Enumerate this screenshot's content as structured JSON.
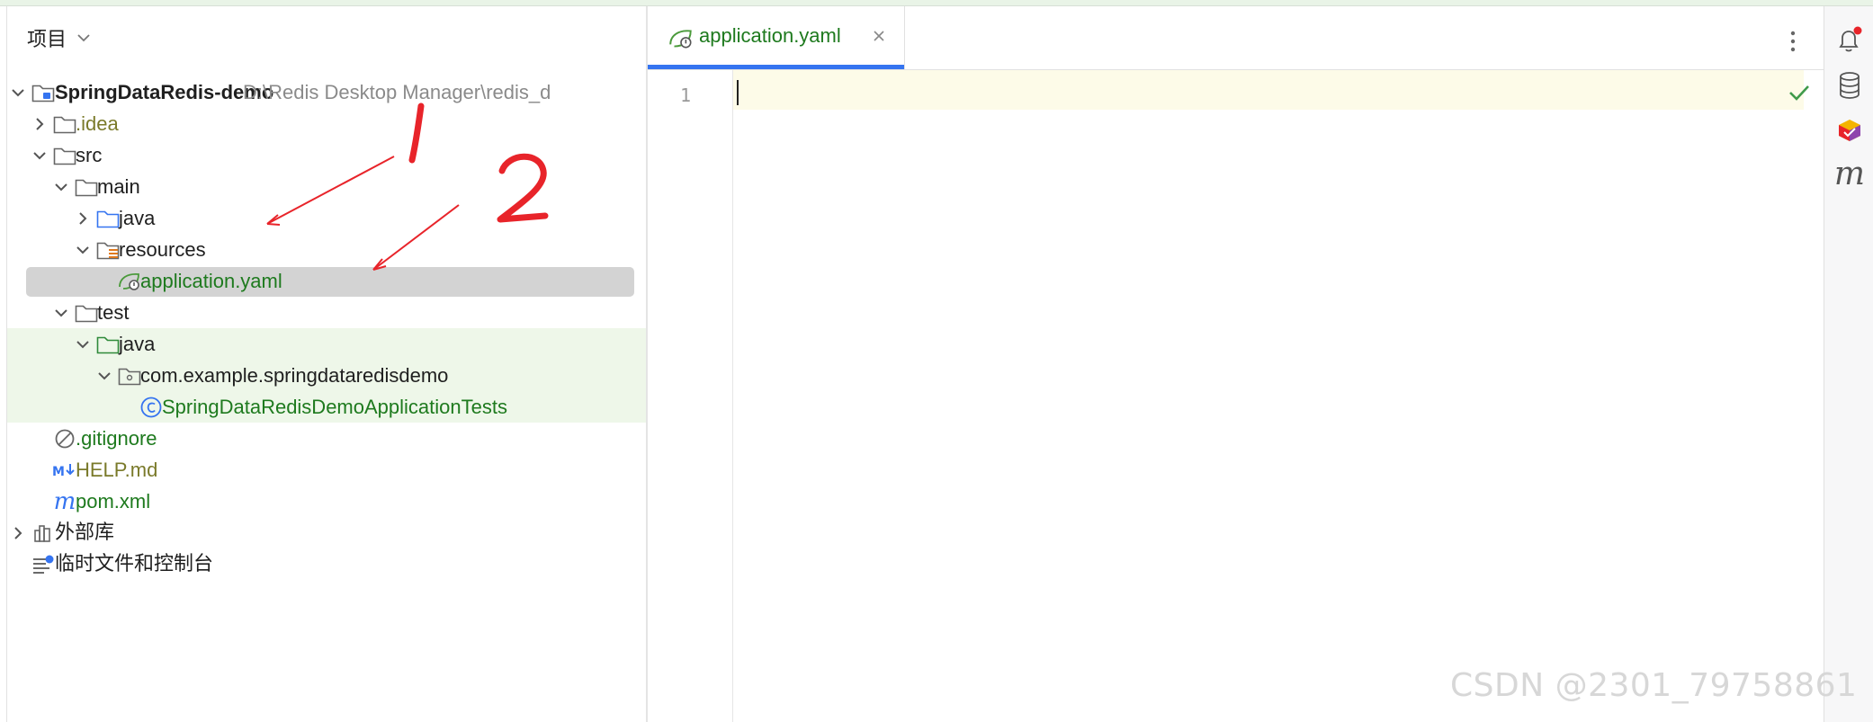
{
  "project_panel": {
    "title": "项目",
    "tree": [
      {
        "label": "SpringDataRedis-demo",
        "path": "D:\\Redis Desktop Manager\\redis_d",
        "icon": "module-folder-icon",
        "expanded": true
      },
      {
        "label": ".idea",
        "icon": "folder-icon",
        "expanded": false
      },
      {
        "label": "src",
        "icon": "folder-icon",
        "expanded": true
      },
      {
        "label": "main",
        "icon": "folder-icon",
        "expanded": true
      },
      {
        "label": "java",
        "icon": "source-folder-icon",
        "expanded": false
      },
      {
        "label": "resources",
        "icon": "resources-folder-icon",
        "expanded": true
      },
      {
        "label": "application.yaml",
        "icon": "spring-yaml-icon",
        "selected": true
      },
      {
        "label": "test",
        "icon": "folder-icon",
        "expanded": true
      },
      {
        "label": "java",
        "icon": "test-folder-icon",
        "expanded": true
      },
      {
        "label": "com.example.springdataredisdemo",
        "icon": "package-icon",
        "expanded": true
      },
      {
        "label": "SpringDataRedisDemoApplicationTests",
        "icon": "class-icon"
      },
      {
        "label": ".gitignore",
        "icon": "ignore-icon"
      },
      {
        "label": "HELP.md",
        "icon": "markdown-icon"
      },
      {
        "label": "pom.xml",
        "icon": "maven-icon"
      },
      {
        "label": "外部库",
        "icon": "library-icon",
        "expanded": false
      },
      {
        "label": "临时文件和控制台",
        "icon": "scratch-icon"
      }
    ]
  },
  "editor": {
    "tab_label": "application.yaml",
    "line_number": "1"
  },
  "annotations": {
    "mark_1": "1",
    "mark_2": "2"
  },
  "watermark": "CSDN @2301_79758861",
  "colors": {
    "accent": "#3574f0",
    "file_green": "#1e7a1e",
    "annotation_red": "#e8242a",
    "selection": "#d3d3d3",
    "test_bg": "#eef7e9"
  }
}
